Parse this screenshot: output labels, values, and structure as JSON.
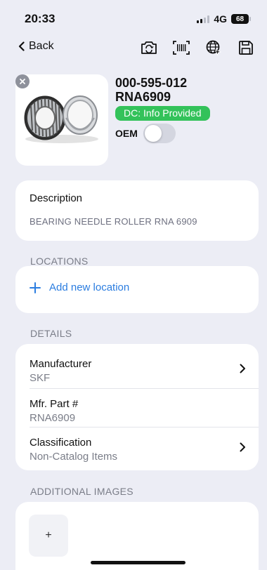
{
  "status_bar": {
    "time": "20:33",
    "network": "4G",
    "battery": "68"
  },
  "nav": {
    "back_label": "Back"
  },
  "product": {
    "part_number": "000-595-012",
    "part_code": "RNA6909",
    "dc_badge": "DC: Info Provided",
    "oem_label": "OEM",
    "oem_enabled": false
  },
  "description": {
    "label": "Description",
    "value": "BEARING NEEDLE ROLLER RNA 6909"
  },
  "locations": {
    "section_title": "LOCATIONS",
    "add_label": "Add new location"
  },
  "details": {
    "section_title": "DETAILS",
    "rows": [
      {
        "label": "Manufacturer",
        "value": "SKF"
      },
      {
        "label": "Mfr. Part #",
        "value": "RNA6909"
      },
      {
        "label": "Classification",
        "value": "Non-Catalog Items"
      }
    ]
  },
  "additional_images": {
    "section_title": "ADDITIONAL IMAGES",
    "add_symbol": "+"
  },
  "colors": {
    "accent": "#2b7de0",
    "badge": "#33c25a",
    "background": "#ecedf5"
  },
  "icons": [
    "chevron-left-icon",
    "camera-rotate-icon",
    "barcode-scan-icon",
    "globe-icon",
    "save-icon",
    "close-icon",
    "plus-icon",
    "chevron-right-icon"
  ]
}
